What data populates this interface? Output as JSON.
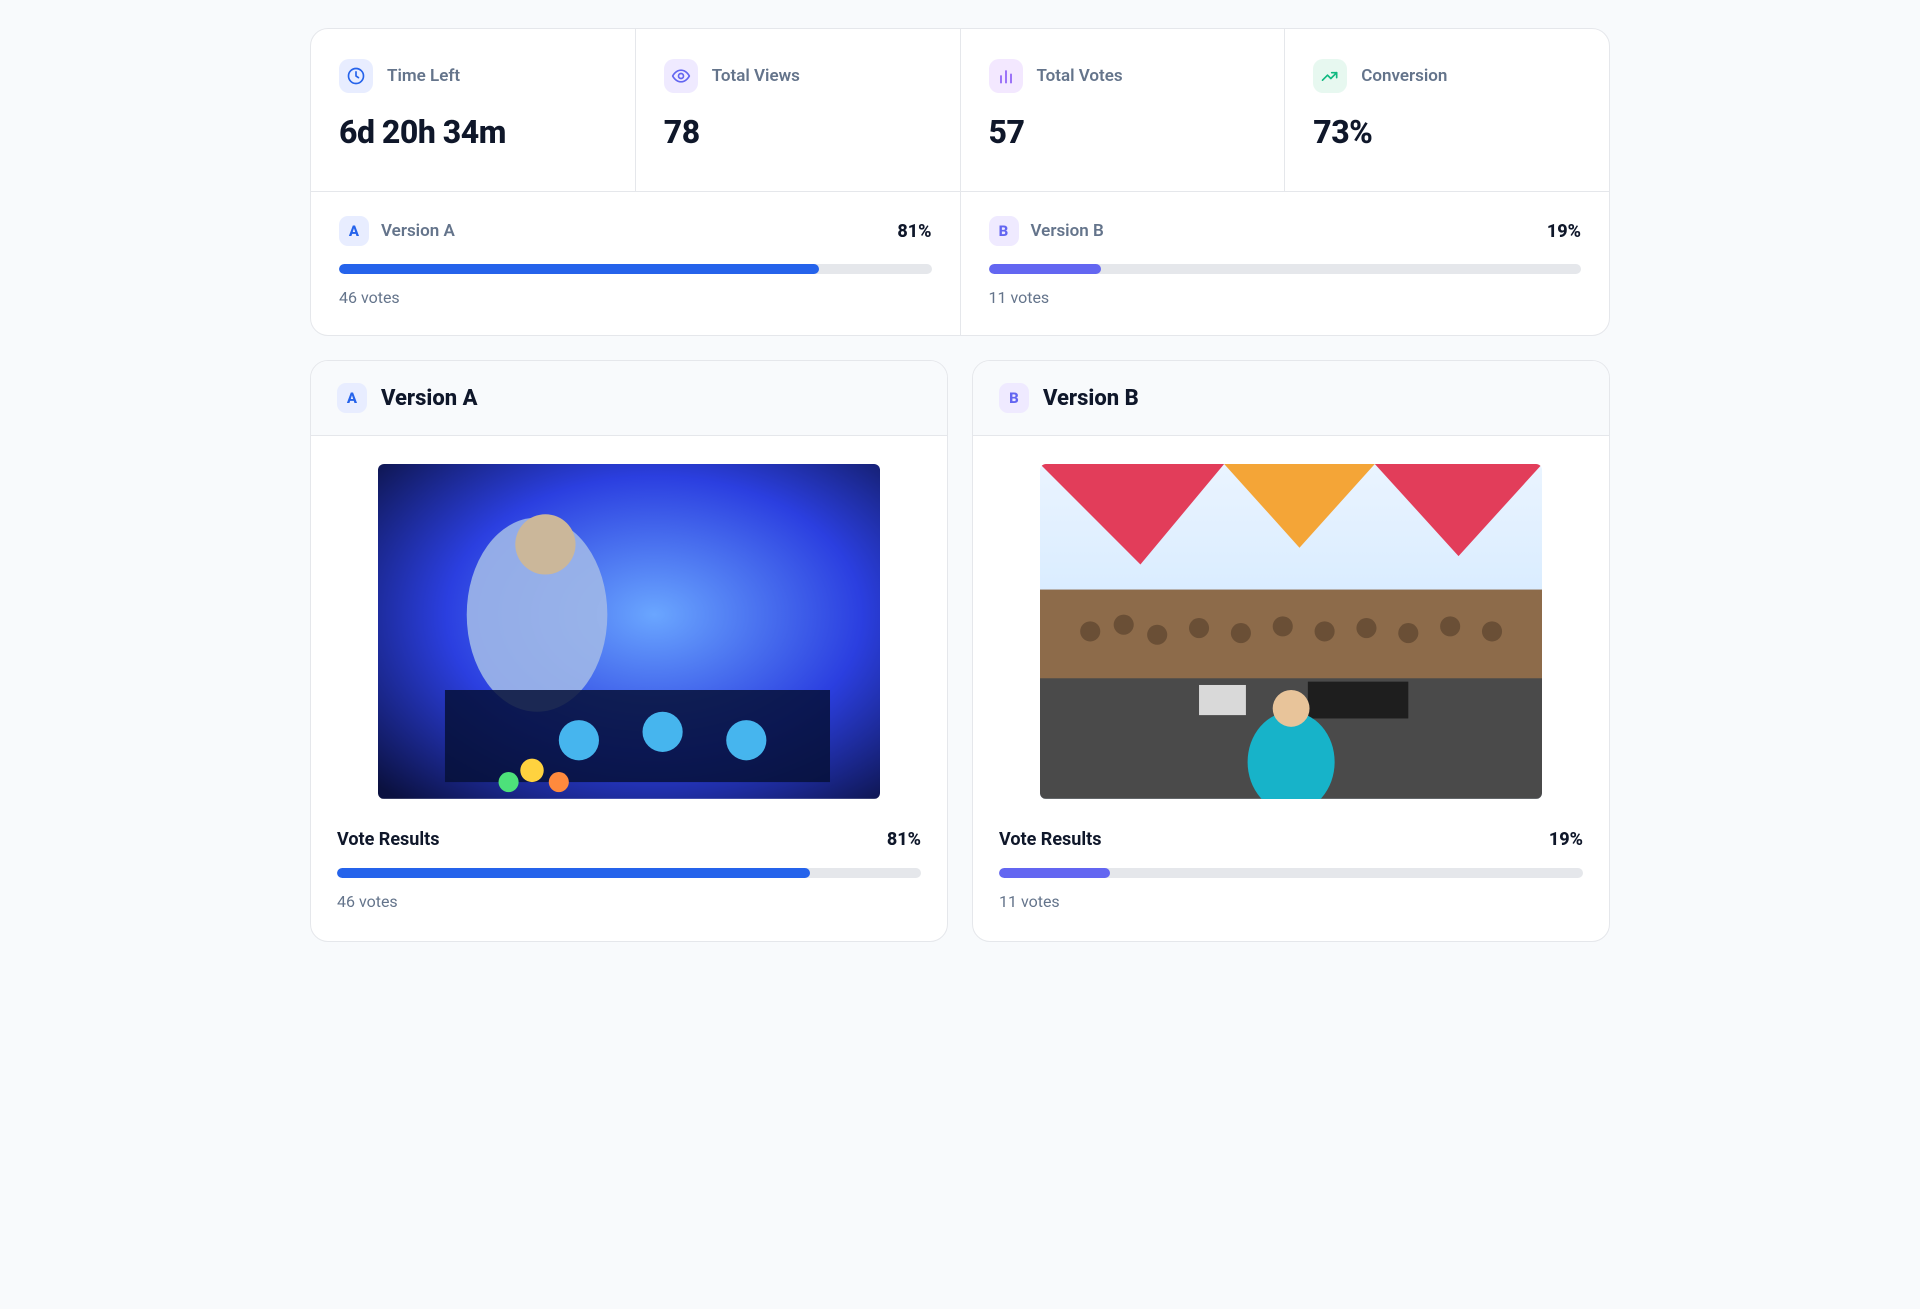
{
  "metrics": {
    "time_left": {
      "label": "Time Left",
      "value": "6d 20h 34m"
    },
    "total_views": {
      "label": "Total Views",
      "value": "78"
    },
    "total_votes": {
      "label": "Total Votes",
      "value": "57"
    },
    "conversion": {
      "label": "Conversion",
      "value": "73%"
    }
  },
  "summary": {
    "a": {
      "badge": "A",
      "name": "Version A",
      "pct": "81%",
      "votes": "46 votes",
      "fill": 81
    },
    "b": {
      "badge": "B",
      "name": "Version B",
      "pct": "19%",
      "votes": "11 votes",
      "fill": 19
    }
  },
  "cards": {
    "a": {
      "badge": "A",
      "title": "Version A",
      "results_label": "Vote Results",
      "pct": "81%",
      "votes": "46 votes",
      "fill": 81,
      "image_alt": "DJ at mixing deck in blue-lit nightclub"
    },
    "b": {
      "badge": "B",
      "title": "Version B",
      "results_label": "Vote Results",
      "pct": "19%",
      "votes": "11 votes",
      "fill": 19,
      "image_alt": "DJ on stage facing large daytime festival crowd under colorful canopies"
    }
  }
}
